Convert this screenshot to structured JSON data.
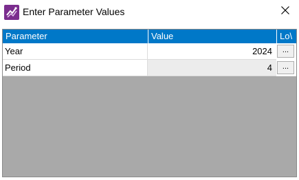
{
  "window": {
    "title": "Enter Parameter Values",
    "icon": "report-parameter-icon",
    "close_icon": "close-icon"
  },
  "grid": {
    "columns": [
      "Parameter",
      "Value",
      "Lo\\"
    ],
    "rows": [
      {
        "parameter": "Year",
        "value": "2024",
        "button": "..."
      },
      {
        "parameter": "Period",
        "value": "4",
        "button": "..."
      }
    ]
  },
  "colors": {
    "header_bg": "#0078c8",
    "grid_empty_bg": "#a9a9a9",
    "selected_value_bg": "#ececec",
    "app_icon": "#7b2d8e"
  }
}
